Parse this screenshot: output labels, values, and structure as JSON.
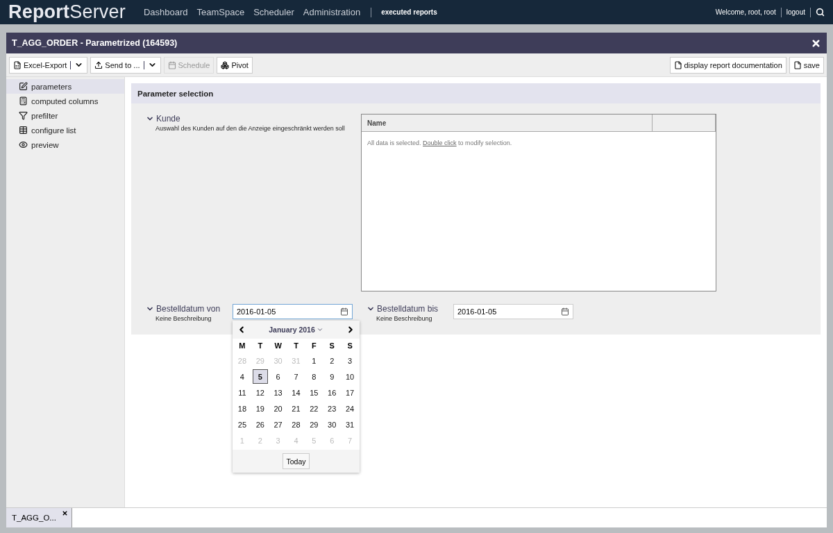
{
  "topbar": {
    "logo_strong": "Report",
    "logo_light": "Server",
    "nav": [
      {
        "label": "Dashboard",
        "selected": false
      },
      {
        "label": "TeamSpace",
        "selected": false
      },
      {
        "label": "Scheduler",
        "selected": false
      },
      {
        "label": "Administration",
        "selected": false
      }
    ],
    "current": "executed reports",
    "welcome": "Welcome, root, root",
    "logout": "logout"
  },
  "window": {
    "title": "T_AGG_ORDER - Parametrized (164593)"
  },
  "toolbar": {
    "left": [
      {
        "kind": "split",
        "label": "Excel-Export",
        "disabled": false
      },
      {
        "kind": "split",
        "label": "Send to ...",
        "disabled": false
      },
      {
        "kind": "plain",
        "label": "Schedule",
        "disabled": true
      },
      {
        "kind": "plain",
        "label": "Pivot",
        "disabled": false
      }
    ],
    "right": [
      {
        "kind": "plain",
        "label": "display report documentation",
        "disabled": false
      },
      {
        "kind": "plain",
        "label": "save",
        "disabled": false
      }
    ]
  },
  "sidebar": {
    "items": [
      {
        "label": "parameters",
        "selected": true
      },
      {
        "label": "computed columns",
        "selected": false
      },
      {
        "label": "prefilter",
        "selected": false
      },
      {
        "label": "configure list",
        "selected": false
      },
      {
        "label": "preview",
        "selected": false
      }
    ]
  },
  "panel": {
    "title": "Parameter selection",
    "parameters": [
      {
        "kind": "list",
        "label": "Kunde",
        "description": "Auswahl des Kunden auf den die Anzeige eingeschränkt werden soll",
        "expanded": true,
        "columns": [
          "Name"
        ],
        "message_before": "All data is selected.",
        "message_link": "Double click",
        "message_after": "to modify selection."
      },
      {
        "kind": "date",
        "label": "Bestelldatum von",
        "description": "Keine Beschreibung",
        "expanded": true,
        "value": "2016-01-05",
        "focused": true,
        "calendar": {
          "month": "January 2016",
          "weekdays": [
            "M",
            "T",
            "W",
            "T",
            "F",
            "S",
            "S"
          ],
          "today": "Today",
          "weeks": [
            [
              {
                "day": "28",
                "outside": true,
                "selected": false
              },
              {
                "day": "29",
                "outside": true,
                "selected": false
              },
              {
                "day": "30",
                "outside": true,
                "selected": false
              },
              {
                "day": "31",
                "outside": true,
                "selected": false
              },
              {
                "day": "1",
                "outside": false,
                "selected": false
              },
              {
                "day": "2",
                "outside": false,
                "selected": false
              },
              {
                "day": "3",
                "outside": false,
                "selected": false
              }
            ],
            [
              {
                "day": "4",
                "outside": false,
                "selected": false
              },
              {
                "day": "5",
                "outside": false,
                "selected": true
              },
              {
                "day": "6",
                "outside": false,
                "selected": false
              },
              {
                "day": "7",
                "outside": false,
                "selected": false
              },
              {
                "day": "8",
                "outside": false,
                "selected": false
              },
              {
                "day": "9",
                "outside": false,
                "selected": false
              },
              {
                "day": "10",
                "outside": false,
                "selected": false
              }
            ],
            [
              {
                "day": "11",
                "outside": false,
                "selected": false
              },
              {
                "day": "12",
                "outside": false,
                "selected": false
              },
              {
                "day": "13",
                "outside": false,
                "selected": false
              },
              {
                "day": "14",
                "outside": false,
                "selected": false
              },
              {
                "day": "15",
                "outside": false,
                "selected": false
              },
              {
                "day": "16",
                "outside": false,
                "selected": false
              },
              {
                "day": "17",
                "outside": false,
                "selected": false
              }
            ],
            [
              {
                "day": "18",
                "outside": false,
                "selected": false
              },
              {
                "day": "19",
                "outside": false,
                "selected": false
              },
              {
                "day": "20",
                "outside": false,
                "selected": false
              },
              {
                "day": "21",
                "outside": false,
                "selected": false
              },
              {
                "day": "22",
                "outside": false,
                "selected": false
              },
              {
                "day": "23",
                "outside": false,
                "selected": false
              },
              {
                "day": "24",
                "outside": false,
                "selected": false
              }
            ],
            [
              {
                "day": "25",
                "outside": false,
                "selected": false
              },
              {
                "day": "26",
                "outside": false,
                "selected": false
              },
              {
                "day": "27",
                "outside": false,
                "selected": false
              },
              {
                "day": "28",
                "outside": false,
                "selected": false
              },
              {
                "day": "29",
                "outside": false,
                "selected": false
              },
              {
                "day": "30",
                "outside": false,
                "selected": false
              },
              {
                "day": "31",
                "outside": false,
                "selected": false
              }
            ],
            [
              {
                "day": "1",
                "outside": true,
                "selected": false
              },
              {
                "day": "2",
                "outside": true,
                "selected": false
              },
              {
                "day": "3",
                "outside": true,
                "selected": false
              },
              {
                "day": "4",
                "outside": true,
                "selected": false
              },
              {
                "day": "5",
                "outside": true,
                "selected": false
              },
              {
                "day": "6",
                "outside": true,
                "selected": false
              },
              {
                "day": "7",
                "outside": true,
                "selected": false
              }
            ]
          ]
        }
      },
      {
        "kind": "date",
        "label": "Bestelldatum bis",
        "description": "Keine Beschreibung",
        "expanded": true,
        "value": "2016-01-05",
        "focused": false
      }
    ]
  },
  "bottom_tabs": [
    {
      "label": "T_AGG_O...",
      "selected": true
    }
  ]
}
